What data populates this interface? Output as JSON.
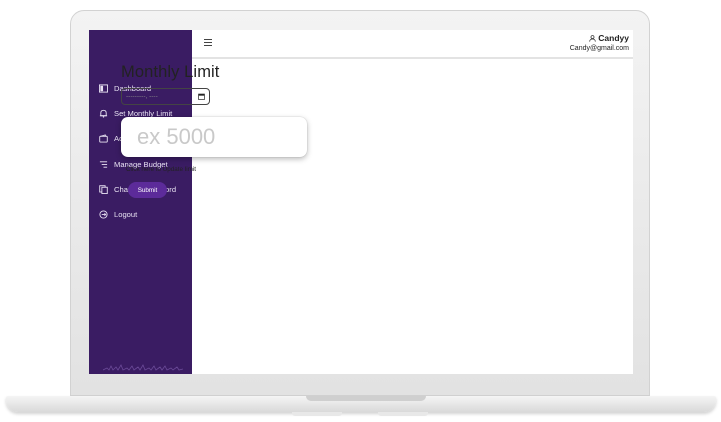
{
  "colors": {
    "sidebar_bg": "#3a1c63",
    "accent": "#5c2b9a",
    "sidebar_text": "#e9e3f3"
  },
  "sidebar": {
    "items": [
      {
        "label": "Dashboard",
        "icon": "dashboard-icon"
      },
      {
        "label": "Set Monthly Limit",
        "icon": "bell-icon"
      },
      {
        "label": "Add Budget",
        "icon": "wallet-icon"
      },
      {
        "label": "Manage Budget",
        "icon": "list-icon"
      },
      {
        "label": "Change Password",
        "icon": "copy-icon"
      },
      {
        "label": "Logout",
        "icon": "logout-icon"
      }
    ]
  },
  "header": {
    "menu_icon": "hamburger-icon",
    "user_icon": "user-icon",
    "user_name": "Candyy",
    "user_email": "Candy@gmail.com"
  },
  "main": {
    "title": "Monthly Limit",
    "date_input": {
      "value": "---------, ----",
      "icon": "calendar-icon"
    },
    "limit_input": {
      "placeholder": "ex 5000",
      "value": ""
    },
    "hint": "Click here to Update limit",
    "submit_label": "Submit"
  }
}
